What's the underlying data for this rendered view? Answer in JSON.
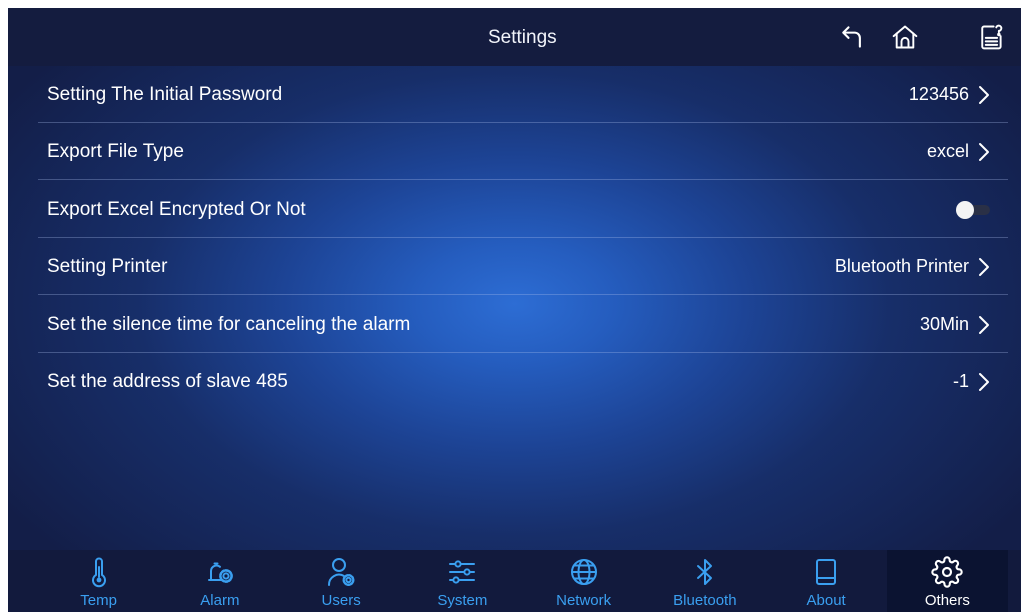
{
  "header": {
    "title": "Settings",
    "icons": [
      "back-arrow-icon",
      "home-icon",
      "help-document-icon"
    ]
  },
  "settings": [
    {
      "label": "Setting The Initial Password",
      "value": "123456"
    },
    {
      "label": "Export File Type",
      "value": "excel"
    },
    {
      "label": "Export Excel Encrypted Or Not",
      "toggle": false
    },
    {
      "label": "Setting Printer",
      "value": "Bluetooth Printer"
    },
    {
      "label": "Set the silence time for canceling the alarm",
      "value": "30Min"
    },
    {
      "label": "Set the address of slave 485",
      "value": "-1"
    }
  ],
  "nav": {
    "selected": "Others",
    "tabs": [
      {
        "label": "Temp",
        "icon": "thermometer-icon"
      },
      {
        "label": "Alarm",
        "icon": "alarm-bell-gear-icon"
      },
      {
        "label": "Users",
        "icon": "user-gear-icon"
      },
      {
        "label": "System",
        "icon": "sliders-icon"
      },
      {
        "label": "Network",
        "icon": "globe-icon"
      },
      {
        "label": "Bluetooth",
        "icon": "bluetooth-icon"
      },
      {
        "label": "About",
        "icon": "tablet-icon"
      },
      {
        "label": "Others",
        "icon": "gear-icon"
      }
    ]
  },
  "colors": {
    "accent": "#3a9ff0",
    "header_bg": "#141c3f",
    "nav_bg": "#121a3d",
    "nav_selected_bg": "#0b1331",
    "text": "#ffffff"
  }
}
